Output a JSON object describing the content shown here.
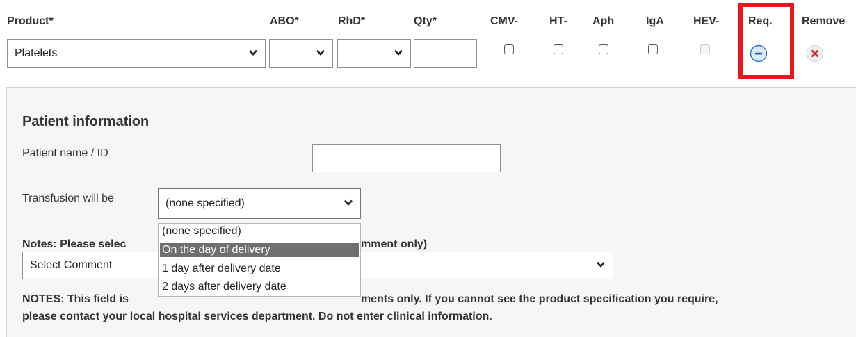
{
  "headers": {
    "product": "Product*",
    "abo": "ABO*",
    "rhd": "RhD*",
    "qty": "Qty*",
    "cmv": "CMV-",
    "ht": "HT-",
    "aph": "Aph",
    "iga": "IgA",
    "hev": "HEV-",
    "req": "Req.",
    "remove": "Remove"
  },
  "row": {
    "product_value": "Platelets",
    "abo_value": "",
    "rhd_value": "",
    "qty_value": "",
    "checkboxes": {
      "cmv": false,
      "ht": false,
      "aph": false,
      "iga": false,
      "hev_disabled": true
    }
  },
  "patient": {
    "heading": "Patient information",
    "name_label": "Patient name / ID",
    "name_value": "",
    "transfusion_label": "Transfusion will be",
    "transfusion_value": "(none specified)",
    "transfusion_options": [
      "(none specified)",
      "On the day of delivery",
      "1 day after delivery date",
      "2 days after delivery date"
    ],
    "highlighted_option": "On the day of delivery"
  },
  "notes": {
    "label_left": "Notes: Please selec",
    "label_right": "mment only)",
    "comment_value": "Select Comment",
    "notes_bold": "NOTES: This field is",
    "notes_line1_tail": "ments only. If you cannot see the product specification you require,",
    "notes_line2": "please contact your local hospital services department. Do not enter clinical information."
  },
  "colors": {
    "highlight_box": "#e8161f",
    "req_icon_fill": "#dbeaf7",
    "req_icon_stroke": "#2b73c8",
    "remove_icon_fill": "#f0f0f0",
    "remove_icon_x": "#d6262c",
    "dropdown_highlight": "#6f6f6f"
  },
  "icons": {
    "req": "minus-circle-icon",
    "remove": "close-x-icon",
    "chevron": "chevron-down-icon"
  }
}
